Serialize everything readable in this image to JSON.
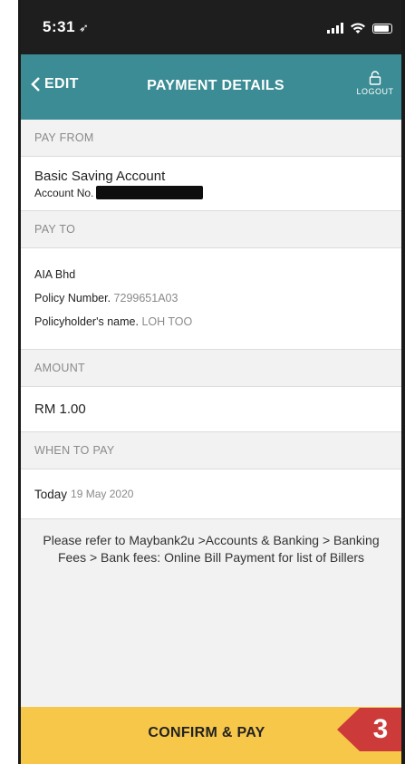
{
  "status_bar": {
    "time": "5:31"
  },
  "nav": {
    "back_label": "EDIT",
    "title": "PAYMENT DETAILS",
    "logout_label": "LOGOUT"
  },
  "pay_from": {
    "header": "PAY FROM",
    "account_name": "Basic Saving Account",
    "account_no_label": "Account No."
  },
  "pay_to": {
    "header": "PAY TO",
    "biller": "AIA Bhd",
    "policy_number_label": "Policy Number.",
    "policy_number": "7299651A03",
    "policyholder_label": "Policyholder's name.",
    "policyholder": "LOH TOO"
  },
  "amount": {
    "header": "AMOUNT",
    "value": "RM 1.00"
  },
  "when": {
    "header": "WHEN TO PAY",
    "label": "Today",
    "date": "19 May 2020"
  },
  "note": "Please refer to Maybank2u >Accounts & Banking > Banking Fees > Bank fees: Online Bill Payment for list of Billers",
  "confirm_label": "CONFIRM & PAY",
  "step_badge": {
    "label": "3",
    "color": "#cc3a3a"
  },
  "colors": {
    "nav": "#3b8c94",
    "confirm": "#f7c74a"
  }
}
